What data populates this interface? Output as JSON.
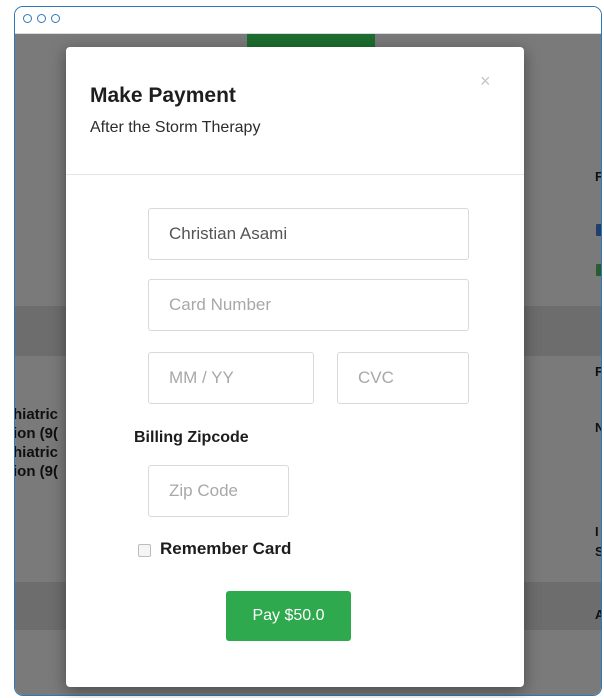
{
  "modal": {
    "title": "Make Payment",
    "subtitle": "After the Storm Therapy",
    "close_icon": "×",
    "name_value": "Christian Asami",
    "card_number_placeholder": "Card Number",
    "expiry_placeholder": "MM / YY",
    "cvc_placeholder": "CVC",
    "zip_label": "Billing Zipcode",
    "zip_placeholder": "Zip Code",
    "remember_label": "Remember Card",
    "pay_label": "Pay $50.0"
  },
  "background": {
    "left_rows": [
      "hiatric",
      "ion (9(",
      "hiatric",
      "ion (9("
    ],
    "right_letters": [
      "F",
      "F",
      "N",
      "I",
      "S",
      "A"
    ]
  },
  "colors": {
    "window_border": "#2f78b7",
    "pay_button": "#2fa94e",
    "overlay": "#7a7a7a"
  }
}
